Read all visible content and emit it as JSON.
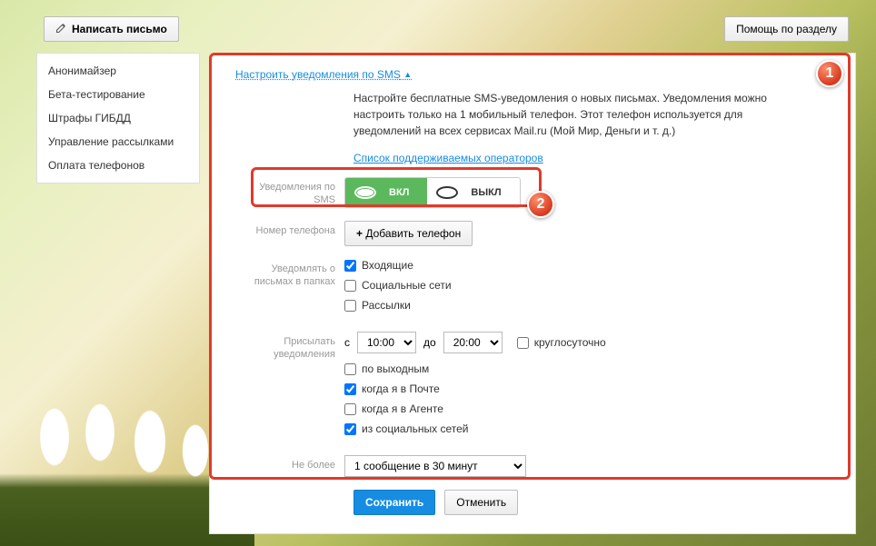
{
  "topbar": {
    "compose": "Написать письмо",
    "help": "Помощь по разделу"
  },
  "sidebar": {
    "items": [
      {
        "label": "Анонимайзер"
      },
      {
        "label": "Бета-тестирование"
      },
      {
        "label": "Штрафы ГИБДД"
      },
      {
        "label": "Управление рассылками"
      },
      {
        "label": "Оплата телефонов"
      }
    ]
  },
  "section": {
    "title": "Настроить уведомления по SMS",
    "desc": "Настройте бесплатные SMS-уведомления о новых письмах. Уведомления можно настроить только на 1 мобильный телефон. Этот телефон используется для уведомлений на всех сервисах Mail.ru (Мой Мир, Деньги и т. д.)",
    "operators_link": "Список поддерживаемых операторов"
  },
  "labels": {
    "sms_toggle": "Уведомления по SMS",
    "phone": "Номер телефона",
    "folders": "Уведомлять о письмах в папках",
    "schedule": "Присылать уведомления",
    "limit": "Не более"
  },
  "toggle": {
    "on": "ВКЛ",
    "off": "ВЫКЛ"
  },
  "phone": {
    "add_button": "Добавить телефон"
  },
  "folders": {
    "items": [
      {
        "label": "Входящие",
        "checked": true
      },
      {
        "label": "Социальные сети",
        "checked": false
      },
      {
        "label": "Рассылки",
        "checked": false
      }
    ]
  },
  "schedule": {
    "from_label": "с",
    "to_label": "до",
    "from": "10:00",
    "to": "20:00",
    "options": [
      {
        "label": "круглосуточно",
        "checked": false
      },
      {
        "label": "по выходным",
        "checked": false
      },
      {
        "label": "когда я в Почте",
        "checked": true
      },
      {
        "label": "когда я в Агенте",
        "checked": false
      },
      {
        "label": "из социальных сетей",
        "checked": true
      }
    ]
  },
  "limit": {
    "value": "1 сообщение в 30 минут"
  },
  "buttons": {
    "save": "Сохранить",
    "cancel": "Отменить"
  },
  "badges": {
    "one": "1",
    "two": "2"
  }
}
